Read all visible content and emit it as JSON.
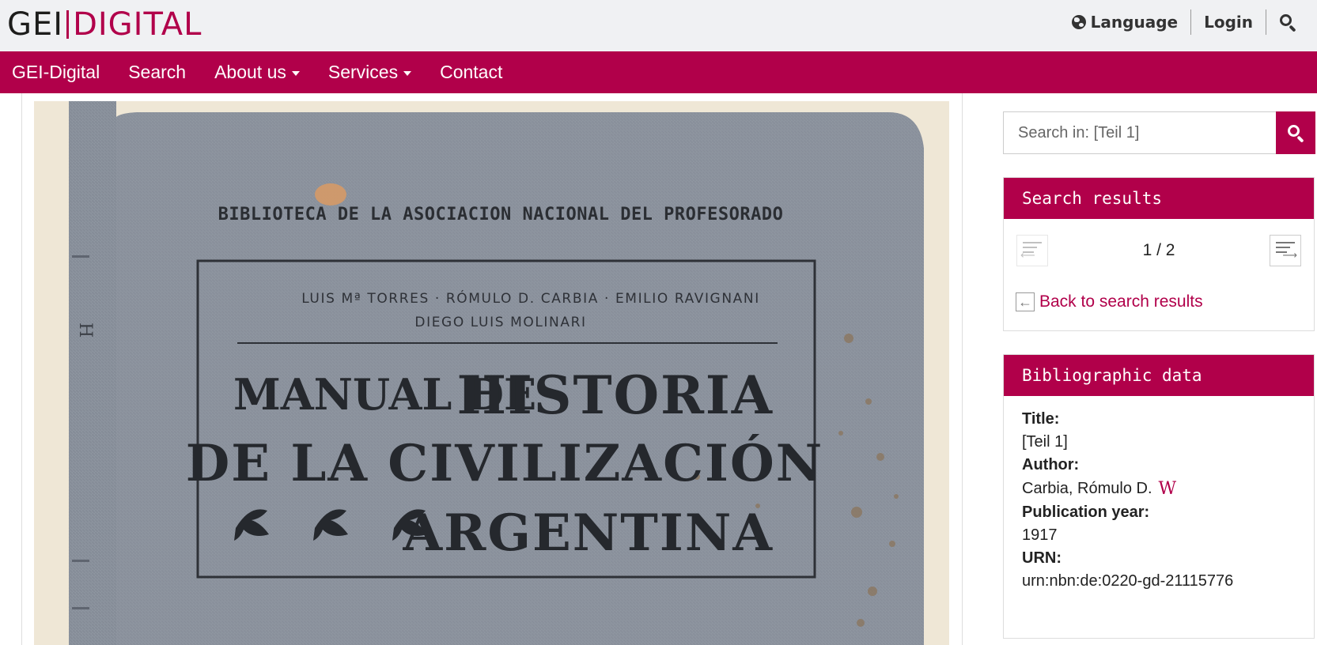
{
  "logo": {
    "part1": "GEI",
    "part2": "DIGITAL"
  },
  "topnav": {
    "language": "Language",
    "login": "Login"
  },
  "mainnav": {
    "items": [
      {
        "label": "GEI-Digital"
      },
      {
        "label": "Search"
      },
      {
        "label": "About us"
      },
      {
        "label": "Services"
      },
      {
        "label": "Contact"
      }
    ]
  },
  "book": {
    "library": "BIBLIOTECA DE LA ASOCIACION NACIONAL DEL PROFESORADO",
    "authors_line1": "LUIS Mª TORRES · RÓMULO D. CARBIA · EMILIO RAVIGNANI",
    "authors_line2": "DIEGO LUIS MOLINARI",
    "title_line1a": "MANUAL DE",
    "title_line1b": "HISTORIA",
    "title_line2": "DE LA CIVILIZACIÓN",
    "title_line3": "ARGENTINA"
  },
  "sidebar": {
    "search_placeholder": "Search in: [Teil 1]",
    "results_title": "Search results",
    "counter": "1 / 2",
    "back_label": "Back to search results",
    "biblio_title": "Bibliographic data",
    "fields": {
      "title_label": "Title:",
      "title_value": "[Teil 1]",
      "author_label": "Author:",
      "author_value": "Carbia, Rómulo D.",
      "wiki_letter": "W",
      "year_label": "Publication year:",
      "year_value": "1917",
      "urn_label": "URN:",
      "urn_value": "urn:nbn:de:0220-gd-21115776"
    }
  }
}
